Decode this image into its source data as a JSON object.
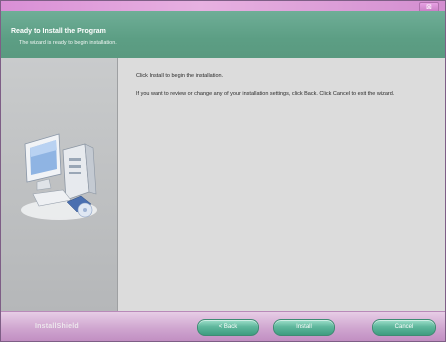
{
  "window": {
    "title": "",
    "close_glyph": "⊠"
  },
  "header": {
    "title": "Ready to Install the Program",
    "subtitle": "The wizard is ready to begin installation."
  },
  "left_panel": {
    "icon": "computer-install-icon"
  },
  "content": {
    "line1": "Click Install to begin the installation.",
    "line2": "If you want to review or change any of your installation settings, click Back. Click Cancel to exit the wizard."
  },
  "footer": {
    "brand": "InstallShield",
    "back_label": "< Back",
    "install_label": "Install",
    "cancel_label": "Cancel"
  },
  "colors": {
    "header": "#5c9e84",
    "titlebar": "#d98fd6",
    "footer": "#cfa5cf",
    "button": "#5fb79c"
  }
}
